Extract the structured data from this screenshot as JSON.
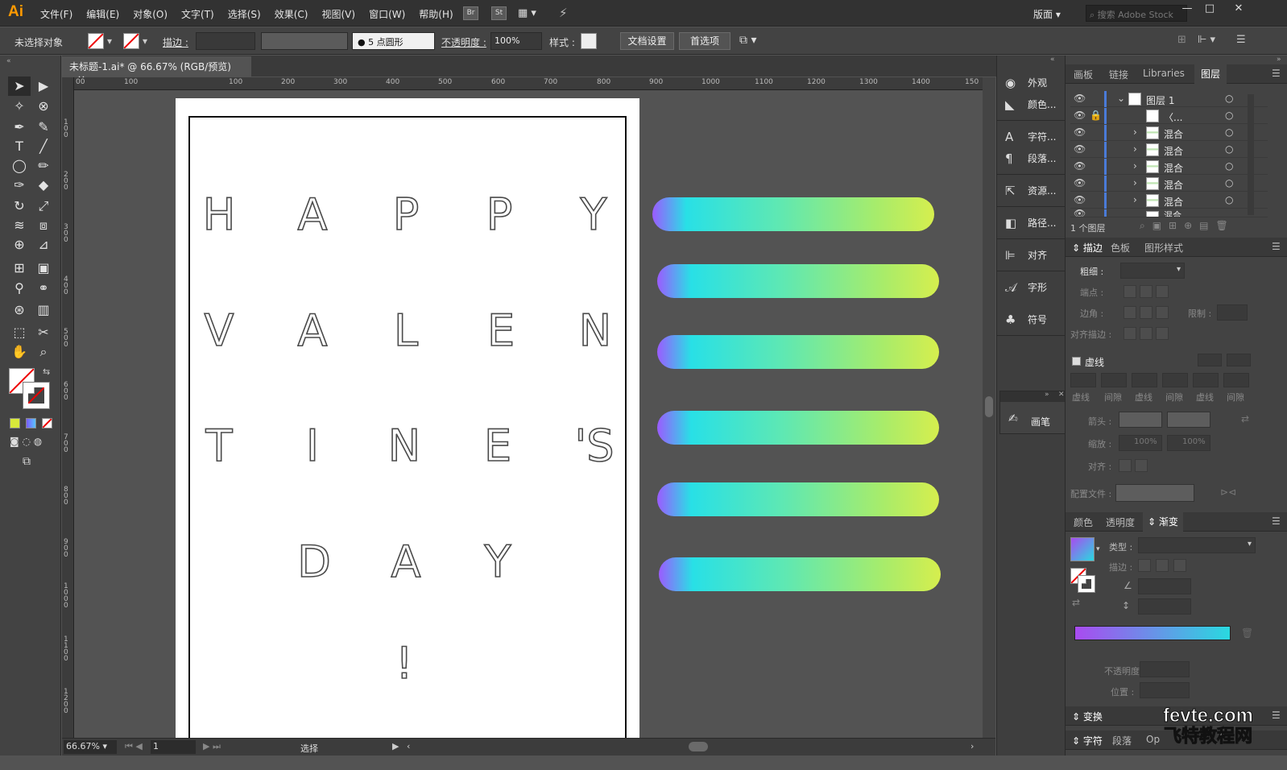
{
  "app": {
    "logo": "Ai",
    "menus": [
      "文件(F)",
      "编辑(E)",
      "对象(O)",
      "文字(T)",
      "选择(S)",
      "效果(C)",
      "视图(V)",
      "窗口(W)",
      "帮助(H)"
    ],
    "bridge_labels": [
      "Br",
      "St"
    ],
    "workspace": "版面",
    "search_placeholder": "搜索 Adobe Stock"
  },
  "control_bar": {
    "selection_label": "未选择对象",
    "stroke_label": "描边 :",
    "brush_value": "5 点圆形",
    "opacity_label": "不透明度 :",
    "opacity_value": "100%",
    "style_label": "样式 :",
    "doc_setup": "文档设置",
    "preferences": "首选项"
  },
  "document_tab": {
    "title": "未标题-1.ai* @ 66.67% (RGB/预览)",
    "close": "×"
  },
  "ruler": {
    "h_labels": [
      "00",
      "100",
      "100",
      "200",
      "300",
      "400",
      "500",
      "600",
      "700",
      "800",
      "900",
      "1000",
      "1100",
      "1200",
      "1300",
      "1400",
      "150"
    ],
    "v_labels": [
      "100",
      "200",
      "300",
      "400",
      "500",
      "600",
      "700",
      "800",
      "900",
      "1000",
      "1100",
      "1200"
    ]
  },
  "artboard": {
    "rows": [
      [
        "H",
        "A",
        "P",
        "P",
        "Y"
      ],
      [
        "V",
        "A",
        "L",
        "E",
        "N"
      ],
      [
        "T",
        "I",
        "N",
        "E",
        "'S"
      ],
      [
        "D",
        "A",
        "Y"
      ],
      [
        "!"
      ]
    ]
  },
  "gradient_bars": {
    "count": 6,
    "colors": [
      "#9b5bff",
      "#28e0e6",
      "#a8ec6a",
      "#d6ee4e"
    ]
  },
  "status_bar": {
    "zoom": "66.67%",
    "page": "1",
    "mode": "选择"
  },
  "dock": {
    "items": [
      {
        "label": "外观",
        "icon": "appearance-icon"
      },
      {
        "label": "颜色...",
        "icon": "color-icon"
      },
      {
        "label": "字符...",
        "icon": "character-icon"
      },
      {
        "label": "段落...",
        "icon": "paragraph-icon"
      },
      {
        "label": "资源...",
        "icon": "assets-icon"
      },
      {
        "label": "路径...",
        "icon": "pathfinder-icon"
      },
      {
        "label": "对齐",
        "icon": "align-icon"
      },
      {
        "label": "字形",
        "icon": "glyphs-icon"
      },
      {
        "label": "符号",
        "icon": "symbols-icon"
      }
    ],
    "floating_brush": "画笔"
  },
  "layers_panel": {
    "tabs": [
      "画板",
      "链接",
      "Libraries",
      "图层"
    ],
    "active_tab": "图层",
    "rows": [
      {
        "name": "图层 1",
        "level": 0
      },
      {
        "name": "〈...",
        "level": 1
      },
      {
        "name": "混合",
        "level": 1
      },
      {
        "name": "混合",
        "level": 1
      },
      {
        "name": "混合",
        "level": 1
      },
      {
        "name": "混合",
        "level": 1
      },
      {
        "name": "混合",
        "level": 1
      },
      {
        "name": "混合",
        "level": 1
      }
    ],
    "footer": "1 个图层"
  },
  "stroke_panel": {
    "tabs": [
      "描边",
      "色板",
      "图形样式"
    ],
    "weight_label": "粗细 :",
    "cap_label": "端点 :",
    "corner_label": "边角 :",
    "limit_label": "限制 :",
    "align_label": "对齐描边 :",
    "dashed_label": "虚线",
    "dash_cols": [
      "虚线",
      "间隙",
      "虚线",
      "间隙",
      "虚线",
      "间隙"
    ],
    "arrow_label": "箭头 :",
    "scale_label": "缩放 :",
    "scale_values": [
      "100%",
      "100%"
    ],
    "align2_label": "对齐 :",
    "profile_label": "配置文件 :"
  },
  "gradient_panel": {
    "tabs": [
      "颜色",
      "透明度",
      "渐变"
    ],
    "type_label": "类型 :",
    "stroke_label": "描边 :",
    "opacity_label": "不透明度 :",
    "location_label": "位置 :",
    "ramp_colors": [
      "#a94bf0",
      "#29d9e0"
    ]
  },
  "bottom_panels": [
    {
      "label": "变换"
    },
    {
      "label": "字符"
    },
    {
      "label": "段落"
    },
    {
      "label": "Op"
    }
  ],
  "watermark": {
    "line1": "fevte.com",
    "line2": "飞特教程网"
  }
}
